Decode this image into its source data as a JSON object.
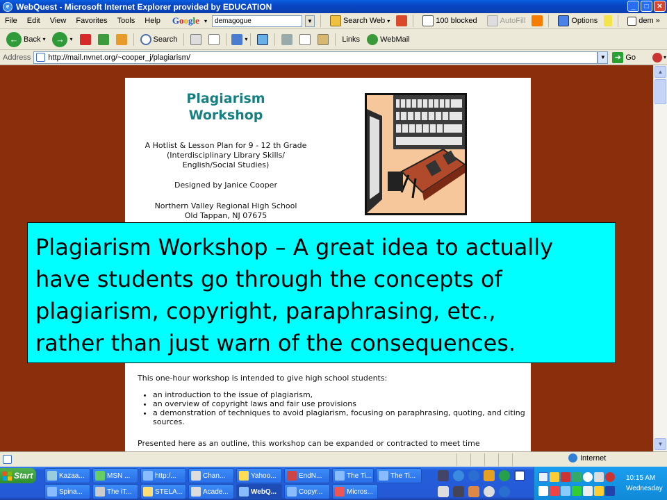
{
  "window": {
    "title": "WebQuest - Microsoft Internet Explorer provided by EDUCATION"
  },
  "menu": [
    "File",
    "Edit",
    "View",
    "Favorites",
    "Tools",
    "Help"
  ],
  "google_toolbar": {
    "search_value": "demagogue",
    "search_web_label": "Search Web",
    "blocked_label": "100 blocked",
    "autofill_label": "AutoFill",
    "options_label": "Options",
    "trailing_text": "dem"
  },
  "toolbar": {
    "back_label": "Back",
    "search_label": "Search",
    "links_label": "Links",
    "webmail_label": "WebMail"
  },
  "address": {
    "label": "Address",
    "url": "http://mail.nvnet.org/~cooper_j/plagiarism/",
    "go_label": "Go"
  },
  "page": {
    "title_line1": "Plagiarism",
    "title_line2": "Workshop",
    "subtitle_lines": [
      "A Hotlist & Lesson Plan for 9 - 12 th Grade",
      "(Interdisciplinary Library Skills/",
      "English/Social Studies)"
    ],
    "author": "Designed by Janice Cooper",
    "school_lines": [
      "Northern Valley Regional High School",
      "Old Tappan, NJ 07675"
    ],
    "intro": "This one-hour workshop is intended to give high school students:",
    "bullets": [
      "an introduction to the issue of plagiarism,",
      "an overview of copyright laws and fair use provisions",
      "a demonstration of techniques to avoid plagiarism, focusing on paraphrasing, quoting, and citing sources."
    ],
    "outro": "Presented here as an outline, this workshop can be expanded or contracted to meet time"
  },
  "caption": {
    "lines": [
      "Plagiarism Workshop – A great idea to actually",
      "have students go through the concepts of",
      "plagiarism, copyright, paraphrasing, etc.,",
      "rather than just warn of the consequences."
    ]
  },
  "status": {
    "zone": "Internet"
  },
  "taskbar": {
    "start": "Start",
    "row1": [
      "Kazaa...",
      "MSN ...",
      "http:/...",
      "Chan...",
      "Yahoo...",
      "EndN...",
      "The Ti...",
      "The Ti..."
    ],
    "row2": [
      "Spina...",
      "The iT...",
      "STELA...",
      "Acade...",
      "WebQ...",
      "Copyr...",
      "Micros..."
    ],
    "time": "10:15 AM",
    "day": "Wednesday"
  },
  "colors": {
    "page_background": "#8b2e0c",
    "caption_background": "#00ffff",
    "title_teal": "#167f7f",
    "titlebar_blue": "#0a4fd0"
  }
}
